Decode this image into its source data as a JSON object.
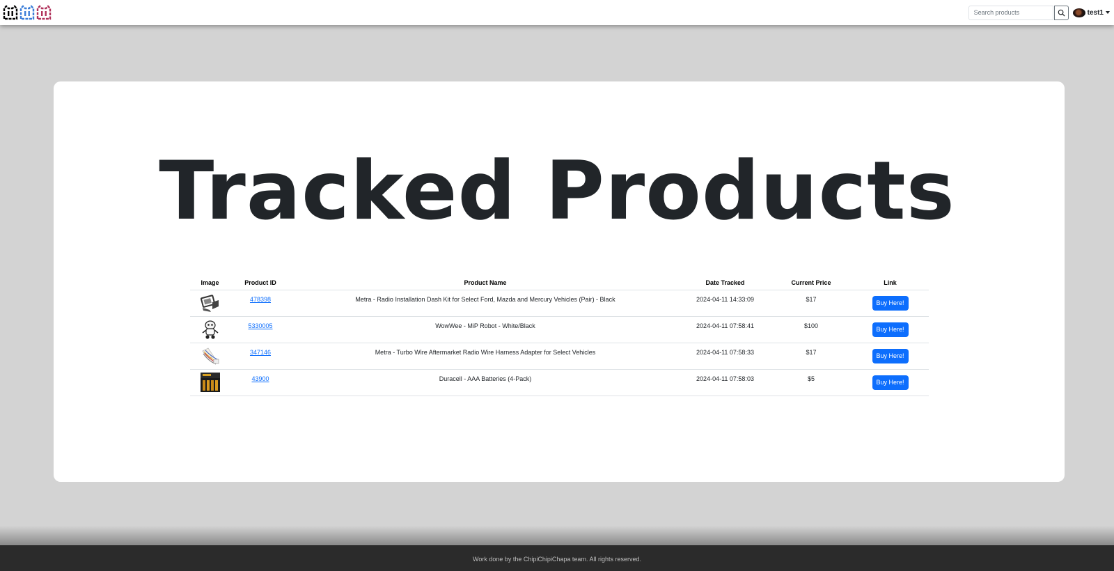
{
  "navbar": {
    "logo_colors": [
      "#000000",
      "#3b7dd8",
      "#b0305a"
    ],
    "search": {
      "placeholder": "Search products",
      "value": ""
    },
    "user": {
      "name": "test1"
    }
  },
  "main": {
    "title": "Tracked Products",
    "table": {
      "headers": {
        "image": "Image",
        "product_id": "Product ID",
        "product_name": "Product Name",
        "date_tracked": "Date Tracked",
        "current_price": "Current Price",
        "link": "Link"
      },
      "rows": [
        {
          "image_icon": "dash-kit-thumbnail",
          "product_id": "478398",
          "product_name": "Metra - Radio Installation Dash Kit for Select Ford, Mazda and Mercury Vehicles (Pair) - Black",
          "date_tracked": "2024-04-11 14:33:09",
          "current_price": "$17",
          "link_label": "Buy Here!"
        },
        {
          "image_icon": "robot-thumbnail",
          "product_id": "5330005",
          "product_name": "WowWee - MiP Robot - White/Black",
          "date_tracked": "2024-04-11 07:58:41",
          "current_price": "$100",
          "link_label": "Buy Here!"
        },
        {
          "image_icon": "wire-harness-thumbnail",
          "product_id": "347146",
          "product_name": "Metra - Turbo Wire Aftermarket Radio Wire Harness Adapter for Select Vehicles",
          "date_tracked": "2024-04-11 07:58:33",
          "current_price": "$17",
          "link_label": "Buy Here!"
        },
        {
          "image_icon": "batteries-thumbnail",
          "product_id": "43900",
          "product_name": "Duracell - AAA Batteries (4-Pack)",
          "date_tracked": "2024-04-11 07:58:03",
          "current_price": "$5",
          "link_label": "Buy Here!"
        }
      ]
    }
  },
  "footer": {
    "text": "Work done by the ChipiChipiChapa team. All rights reserved."
  },
  "colors": {
    "background": "#d3d3d3",
    "accent": "#0d6efd",
    "footer": "#2b2b2b"
  }
}
